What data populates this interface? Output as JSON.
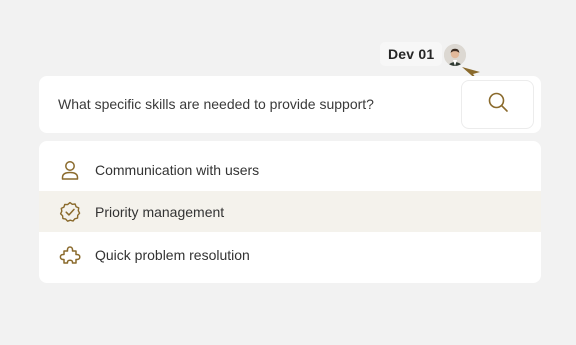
{
  "cursor": {
    "user_name": "Dev 01",
    "pointer_color": "#8a6a2c"
  },
  "search": {
    "query": "What specific skills are needed to provide support?",
    "button_icon": "search-icon"
  },
  "results": [
    {
      "label": "Communication with users",
      "icon": "user-icon"
    },
    {
      "label": "Priority management",
      "icon": "check-badge-icon"
    },
    {
      "label": "Quick problem resolution",
      "icon": "puzzle-icon"
    }
  ],
  "colors": {
    "accent": "#8a6a2c",
    "highlight_row": "#f4f2ec",
    "background": "#f2f2f2"
  }
}
